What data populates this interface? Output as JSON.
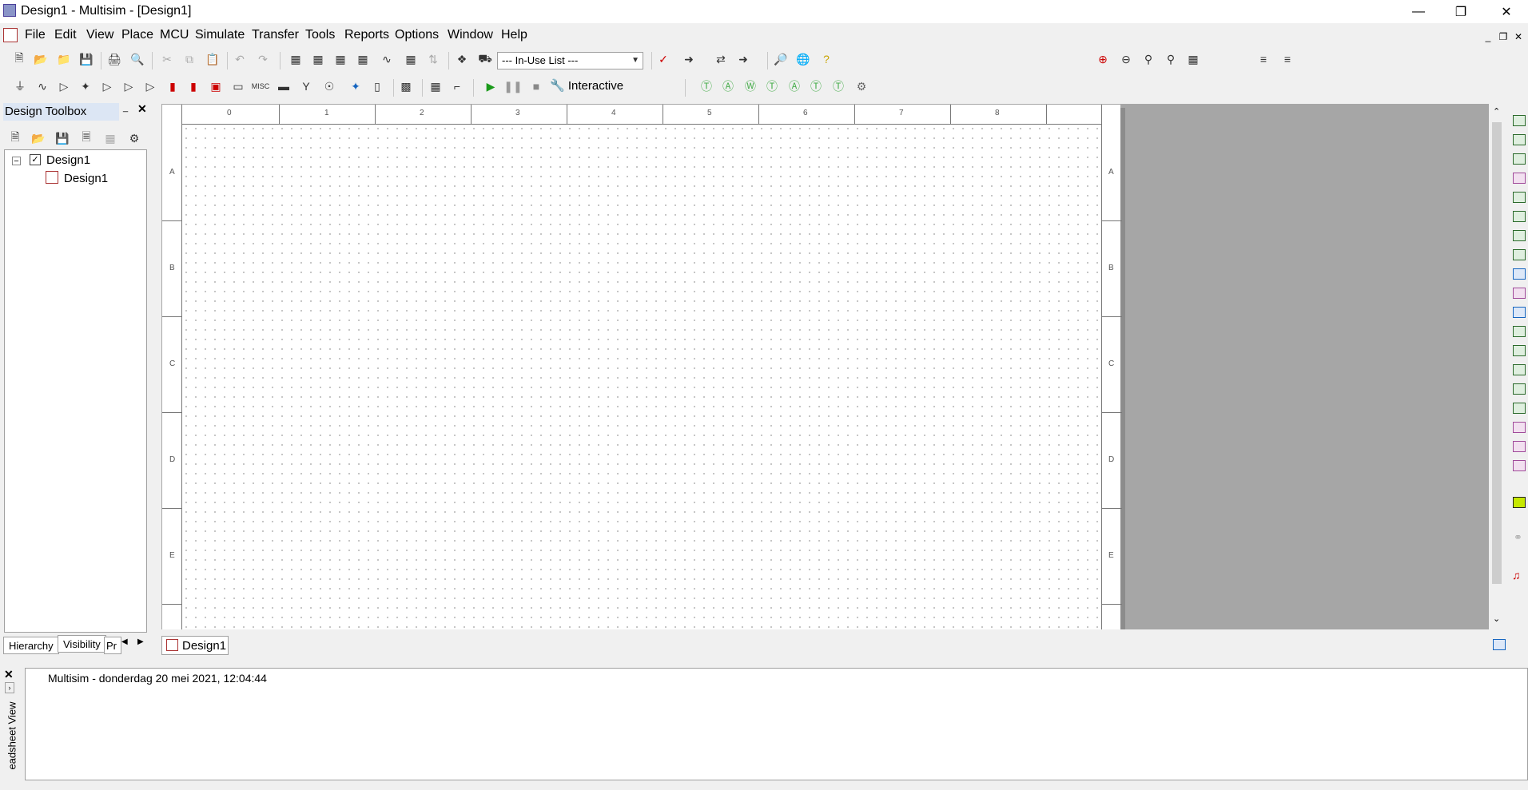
{
  "window": {
    "title": "Design1 - Multisim - [Design1]"
  },
  "menu": [
    "File",
    "Edit",
    "View",
    "Place",
    "MCU",
    "Simulate",
    "Transfer",
    "Tools",
    "Reports",
    "Options",
    "Window",
    "Help"
  ],
  "toolbar": {
    "in_use_list": "--- In-Use List ---",
    "interactive": "Interactive"
  },
  "toolbox": {
    "title": "Design Toolbox",
    "root": "Design1",
    "child": "Design1",
    "tabs": [
      "Hierarchy",
      "Visibility",
      "Pr"
    ]
  },
  "ruler": {
    "columns": [
      "0",
      "1",
      "2",
      "3",
      "4",
      "5",
      "6",
      "7",
      "8"
    ],
    "rows": [
      "A",
      "B",
      "C",
      "D",
      "E"
    ]
  },
  "sheet_tab": "Design1",
  "output": {
    "message": "Multisim  -  donderdag 20 mei 2021, 12:04:44",
    "side_label": "eadsheet View"
  }
}
